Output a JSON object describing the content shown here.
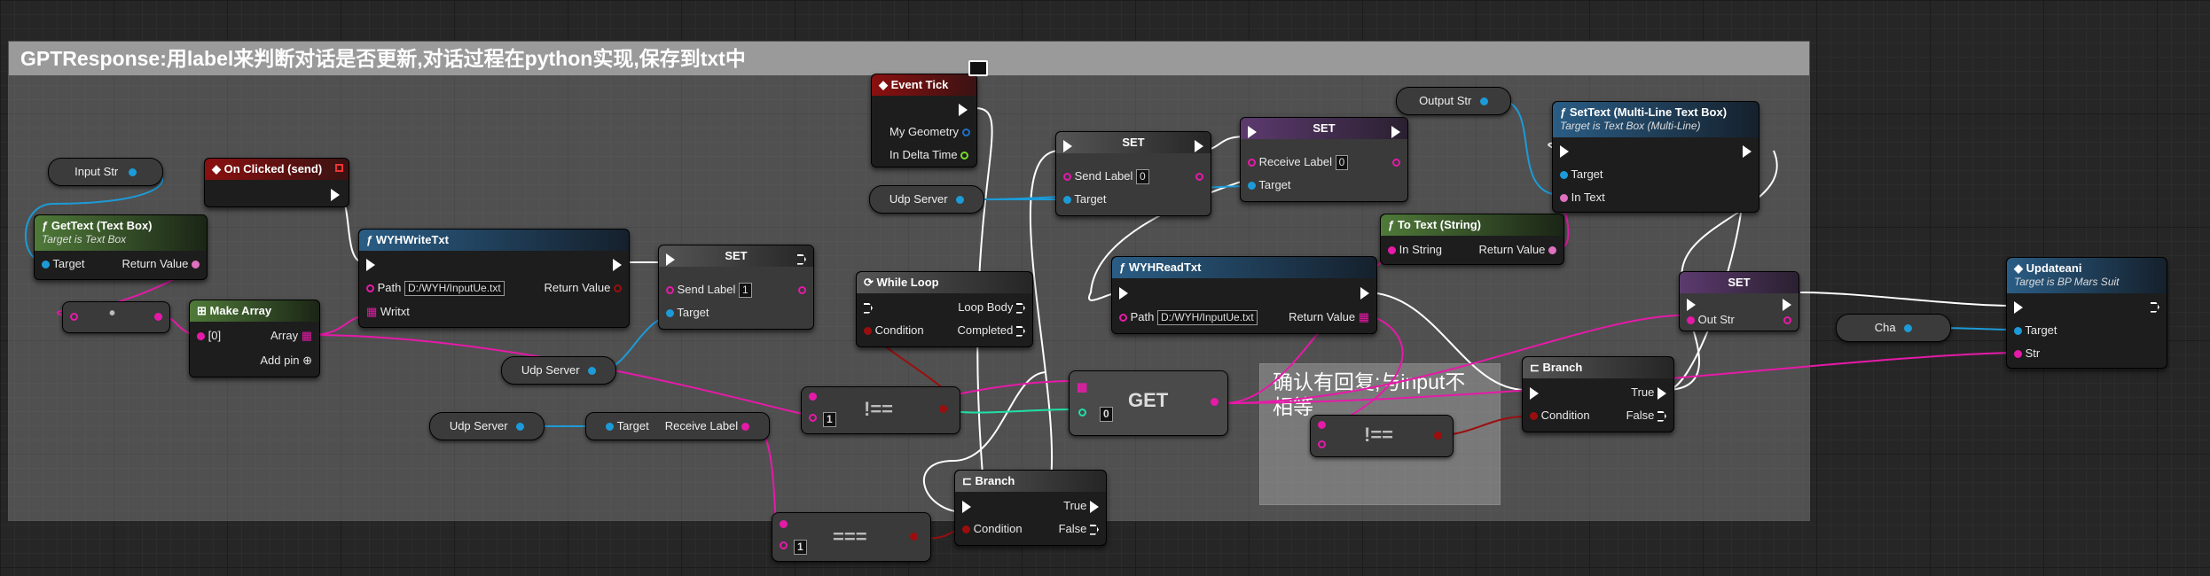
{
  "comment": {
    "title": "GPTResponse:用label来判断对话是否更新,对话过程在python实现,保存到txt中"
  },
  "comment_note": {
    "text": "确认有回复;与input不相等"
  },
  "nodes": {
    "event_tick": {
      "title": "Event Tick",
      "my_geometry": "My Geometry",
      "in_delta_time": "In Delta Time"
    },
    "on_clicked": {
      "title": "On Clicked (send)"
    },
    "gettext": {
      "title": "GetText (Text Box)",
      "subtitle": "Target is Text Box",
      "target": "Target",
      "return_value": "Return Value"
    },
    "make_array": {
      "title": "Make Array",
      "index0": "[0]",
      "array": "Array",
      "add_pin": "Add pin"
    },
    "wyh_write": {
      "title": "WYHWriteTxt",
      "path_label": "Path",
      "path_value": "D:/WYH/InputUe.txt",
      "return_value": "Return Value",
      "writxt": "Writxt"
    },
    "set_send": {
      "title": "SET",
      "send_label": "Send Label",
      "send_value": "1",
      "target": "Target"
    },
    "while_loop": {
      "title": "While Loop",
      "loop_body": "Loop Body",
      "condition": "Condition",
      "completed": "Completed"
    },
    "set_send0": {
      "title": "SET",
      "send_label": "Send Label",
      "send_value": "0",
      "target": "Target"
    },
    "set_receive0": {
      "title": "SET",
      "receive_label": "Receive Label",
      "receive_value": "0",
      "target": "Target"
    },
    "settext_ml": {
      "title": "SetText (Multi-Line Text Box)",
      "subtitle": "Target is Text Box (Multi-Line)",
      "target": "Target",
      "in_text": "In Text"
    },
    "to_text": {
      "title": "To Text (String)",
      "in_string": "In String",
      "return_value": "Return Value"
    },
    "wyh_read": {
      "title": "WYHReadTxt",
      "path_label": "Path",
      "path_value": "D:/WYH/InputUe.txt",
      "return_value": "Return Value"
    },
    "get": {
      "title": "GET",
      "index": "0"
    },
    "branch1": {
      "title": "Branch",
      "true": "True",
      "condition": "Condition",
      "false": "False"
    },
    "branch2": {
      "title": "Branch",
      "true": "True",
      "condition": "Condition",
      "false": "False"
    },
    "set_outstr": {
      "title": "SET",
      "out_str": "Out Str"
    },
    "updateani": {
      "title": "Updateani",
      "subtitle": "Target is BP Mars Suit",
      "target": "Target",
      "str": "Str"
    },
    "receive_label": {
      "target": "Target",
      "receive_label": "Receive Label"
    },
    "neq1": {
      "op": "!==",
      "value": "1"
    },
    "neq2": {
      "op": "!=="
    },
    "eq": {
      "op": "===",
      "value": "1"
    },
    "concat": {
      "op": "•"
    }
  },
  "variables": {
    "input_str": "Input Str",
    "udp_server_1": "Udp Server",
    "udp_server_2": "Udp Server",
    "udp_server_3": "Udp Server",
    "output_str": "Output Str",
    "cha": "Cha"
  },
  "colors": {
    "exec": "#ffffff",
    "object": "#1c9bd8",
    "string": "#e61aa8",
    "integer": "#1fe0a8",
    "boolean": "#9b0e0e",
    "struct": "#1e6fc7",
    "float": "#7ad82a",
    "text": "#e070c0"
  }
}
